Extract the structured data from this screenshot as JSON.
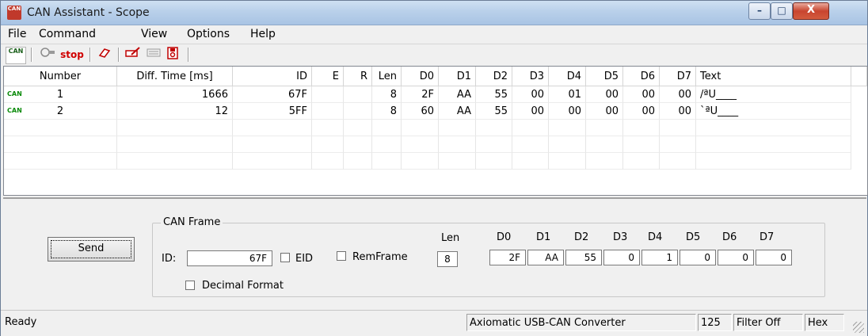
{
  "window": {
    "title": "CAN Assistant - Scope",
    "icon_text": "CAN",
    "controls": {
      "minimize": "–",
      "maximize": "□",
      "close": "X"
    }
  },
  "menu": [
    {
      "label": "File"
    },
    {
      "label": "Command"
    },
    {
      "label": "View"
    },
    {
      "label": "Options"
    },
    {
      "label": "Help"
    }
  ],
  "toolbar": {
    "connect_icon": "CAN",
    "scope_icon": "scope-icon",
    "stop_label": "stop",
    "erase_icon": "eraser-icon",
    "edit_icon": "edit-icon",
    "list_icon": "list-icon",
    "save_icon": "save-icon"
  },
  "table": {
    "columns": [
      "Number",
      "Diff. Time [ms]",
      "ID",
      "E",
      "R",
      "Len",
      "D0",
      "D1",
      "D2",
      "D3",
      "D4",
      "D5",
      "D6",
      "D7",
      "Text"
    ],
    "rows": [
      {
        "tag": "CAN",
        "number": "1",
        "diff": "1666",
        "id": "67F",
        "e": "",
        "r": "",
        "len": "8",
        "d0": "2F",
        "d1": "AA",
        "d2": "55",
        "d3": "00",
        "d4": "01",
        "d5": "00",
        "d6": "00",
        "d7": "00",
        "text": "/ªU____"
      },
      {
        "tag": "CAN",
        "number": "2",
        "diff": "12",
        "id": "5FF",
        "e": "",
        "r": "",
        "len": "8",
        "d0": "60",
        "d1": "AA",
        "d2": "55",
        "d3": "00",
        "d4": "00",
        "d5": "00",
        "d6": "00",
        "d7": "00",
        "text": "`ªU____"
      }
    ]
  },
  "frame": {
    "send_label": "Send",
    "group_title": "CAN Frame",
    "id_label": "ID:",
    "id_value": "67F",
    "eid_label": "EID",
    "remframe_label": "RemFrame",
    "decimal_label": "Decimal Format",
    "len_label": "Len",
    "len_value": "8",
    "data_labels": [
      "D0",
      "D1",
      "D2",
      "D3",
      "D4",
      "D5",
      "D6",
      "D7"
    ],
    "data_values": [
      "2F",
      "AA",
      "55",
      "0",
      "1",
      "0",
      "0",
      "0"
    ]
  },
  "status": {
    "ready": "Ready",
    "device": "Axiomatic USB-CAN Converter",
    "bitrate": "125",
    "filter": "Filter Off",
    "format": "Hex"
  }
}
